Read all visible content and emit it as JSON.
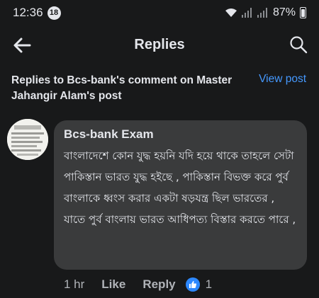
{
  "status_bar": {
    "time": "12:36",
    "notification_count": "18",
    "battery": "87%"
  },
  "header": {
    "title": "Replies"
  },
  "context": {
    "text": "Replies to Bcs-bank's comment on Master Jahangir Alam's post",
    "view_post_label": "View post"
  },
  "comment": {
    "author": "Bcs-bank Exam",
    "text": "বাংলাদেশে কোন যুদ্ধ হয়নি যদি হয়ে থাকে তাহলে সেটা পাকিস্তান ভারত যুদ্ধ হইছে , পাকিস্তান বিভক্ত করে পুর্ব বাংলাকে ধ্বংস করার একটা ষড়যন্ত্র ছিল ভারতের , যাতে পুর্ব বাংলায় ভারত আধিপত্য বিস্তার করতে পারে ,",
    "time": "1 hr",
    "like_label": "Like",
    "reply_label": "Reply",
    "reaction_count": "1"
  },
  "colors": {
    "background": "#18191a",
    "bubble": "#3a3b3c",
    "link": "#4599ff",
    "like_badge": "#2d88ff"
  }
}
